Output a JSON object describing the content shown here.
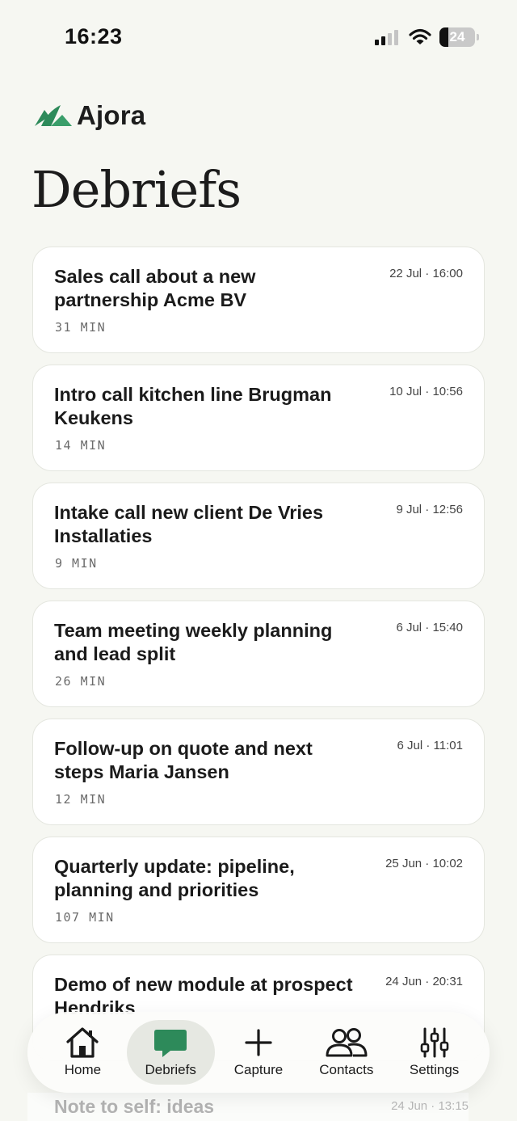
{
  "status_bar": {
    "time": "16:23",
    "battery": "24"
  },
  "brand": {
    "name": "Ajora",
    "accent": "#2d8a5a"
  },
  "page": {
    "title": "Debriefs"
  },
  "debriefs": [
    {
      "title": "Sales call about a new partnership Acme BV",
      "date": "22 Jul · 16:00",
      "duration": "31 MIN"
    },
    {
      "title": "Intro call kitchen line Brugman Keukens",
      "date": "10 Jul · 10:56",
      "duration": "14 MIN"
    },
    {
      "title": "Intake call new client De Vries Installaties",
      "date": "9 Jul · 12:56",
      "duration": "9 MIN"
    },
    {
      "title": "Team meeting weekly planning and lead split",
      "date": "6 Jul · 15:40",
      "duration": "26 MIN"
    },
    {
      "title": "Follow-up on quote and next steps Maria Jansen",
      "date": "6 Jul · 11:01",
      "duration": "12 MIN"
    },
    {
      "title": "Quarterly update: pipeline, planning and priorities",
      "date": "25 Jun · 10:02",
      "duration": "107 MIN"
    },
    {
      "title": "Demo of new module at prospect Hendriks",
      "date": "24 Jun · 20:31",
      "duration": ""
    }
  ],
  "partial_item": {
    "title": "Note to self: ideas",
    "date": "24 Jun · 13:15"
  },
  "tabs": [
    {
      "label": "Home",
      "icon": "home-icon",
      "active": false
    },
    {
      "label": "Debriefs",
      "icon": "chat-bubble-icon",
      "active": true
    },
    {
      "label": "Capture",
      "icon": "plus-icon",
      "active": false
    },
    {
      "label": "Contacts",
      "icon": "contacts-icon",
      "active": false
    },
    {
      "label": "Settings",
      "icon": "sliders-icon",
      "active": false
    }
  ]
}
